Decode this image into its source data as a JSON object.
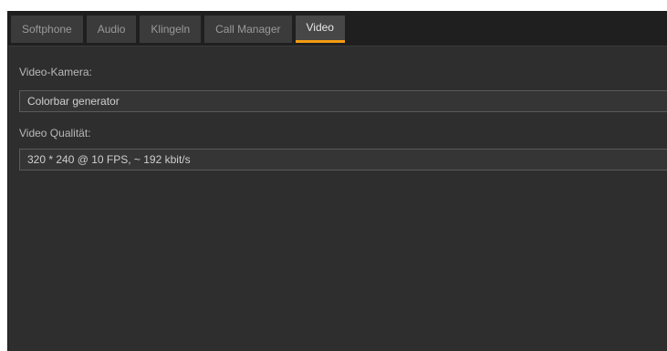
{
  "tabs": [
    {
      "label": "Softphone"
    },
    {
      "label": "Audio"
    },
    {
      "label": "Klingeln"
    },
    {
      "label": "Call Manager"
    },
    {
      "label": "Video"
    }
  ],
  "active_tab": "Video",
  "video": {
    "camera_label": "Video-Kamera:",
    "camera_value": "Colorbar generator",
    "quality_label": "Video Qualität:",
    "quality_value": "320 * 240 @ 10 FPS, ~ 192 kbit/s"
  },
  "colors": {
    "accent": "#f39c12",
    "background": "#2e2e2e"
  }
}
